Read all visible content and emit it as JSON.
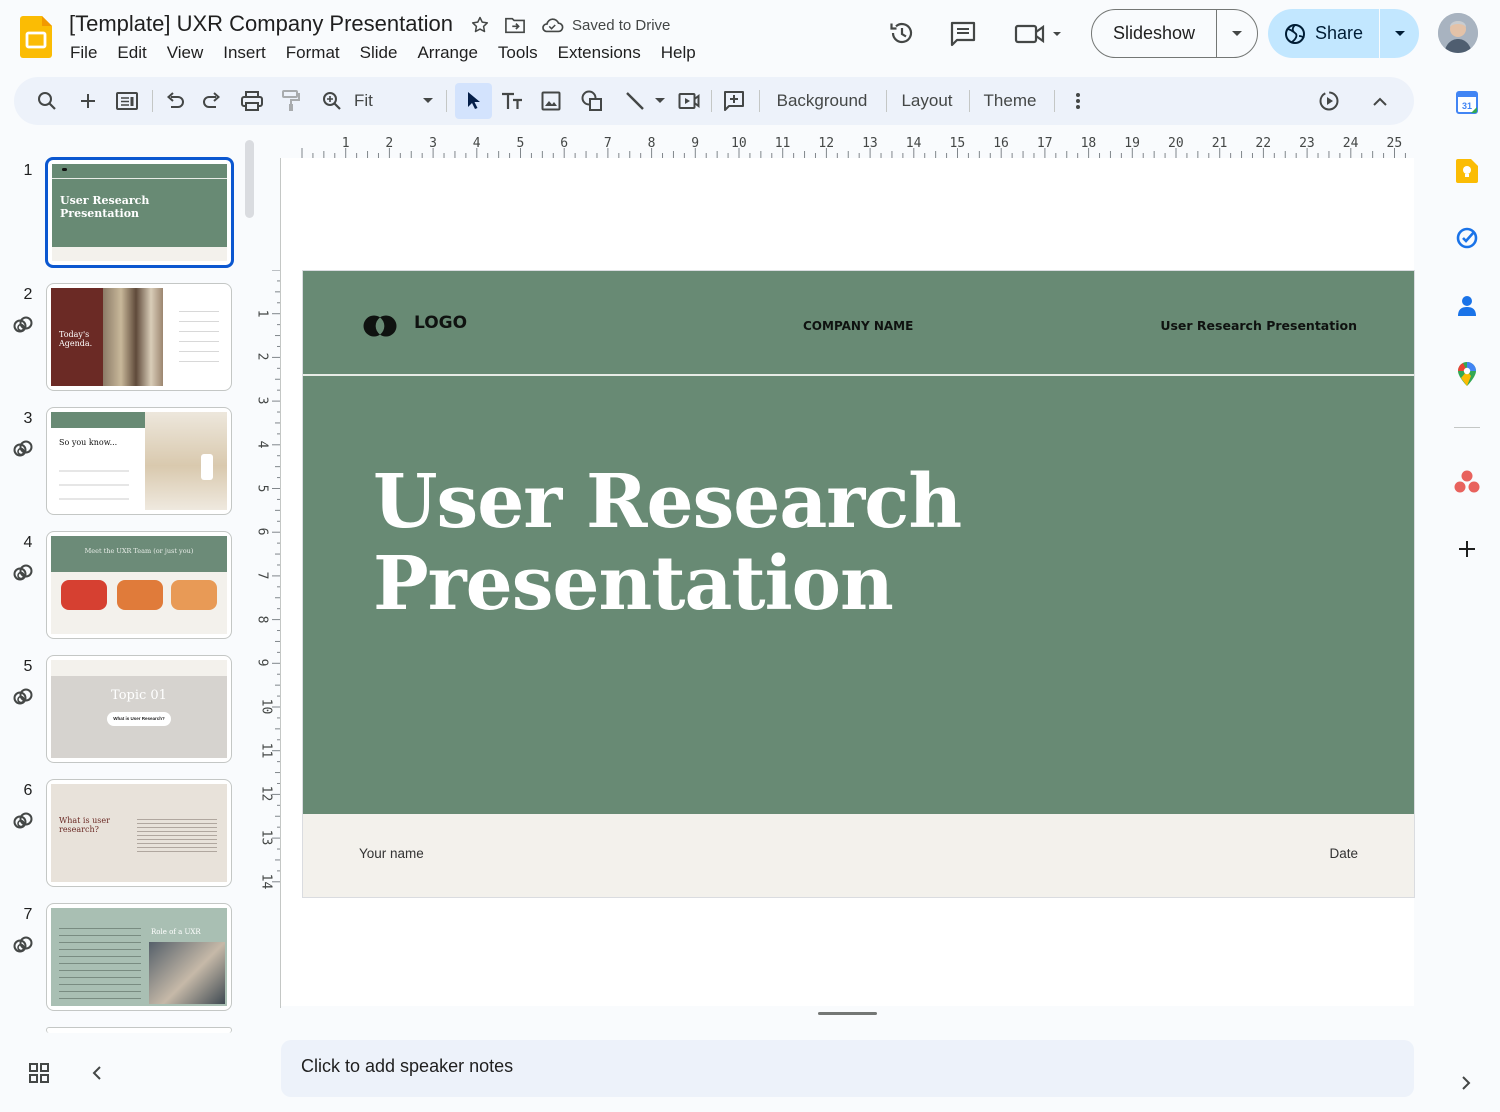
{
  "app": {
    "doc_title": "[Template] UXR Company Presentation",
    "saved_status": "Saved to Drive",
    "menu": [
      "File",
      "Edit",
      "View",
      "Insert",
      "Format",
      "Slide",
      "Arrange",
      "Tools",
      "Extensions",
      "Help"
    ],
    "slideshow_label": "Slideshow",
    "share_label": "Share"
  },
  "toolbar": {
    "zoom_label": "Fit",
    "background_label": "Background",
    "layout_label": "Layout",
    "theme_label": "Theme"
  },
  "ruler": {
    "h": [
      "1",
      "2",
      "3",
      "4",
      "5",
      "6",
      "7",
      "8",
      "9",
      "10",
      "11",
      "12",
      "13",
      "14",
      "15",
      "16",
      "17",
      "18",
      "19",
      "20",
      "21",
      "22",
      "23",
      "24",
      "25"
    ],
    "v": [
      "1",
      "2",
      "3",
      "4",
      "5",
      "6",
      "7",
      "8",
      "9",
      "10",
      "11",
      "12",
      "13",
      "14"
    ]
  },
  "filmstrip": {
    "numbers": [
      "1",
      "2",
      "3",
      "4",
      "5",
      "6",
      "7"
    ],
    "t1_title": "User Research Presentation",
    "t2_title": "Today's Agenda.",
    "t3_title": "So you know...",
    "t4_title": "Meet the UXR Team (or just you)",
    "t5_title": "Topic 01",
    "t5_pill": "What is User Research?",
    "t6_title": "What is user research?",
    "t7_title": "Role of a UXR"
  },
  "slide": {
    "logo": "LOGO",
    "company": "COMPANY NAME",
    "presentation": "User Research Presentation",
    "title_line1": "User Research",
    "title_line2": "Presentation",
    "your_name": "Your name",
    "date": "Date"
  },
  "notes_placeholder": "Click to add speaker notes",
  "colors": {
    "slide_green": "#688a74",
    "footer_beige": "#f3f1ec",
    "share_blue": "#c2e7ff",
    "selection_blue": "#0b57d0"
  }
}
